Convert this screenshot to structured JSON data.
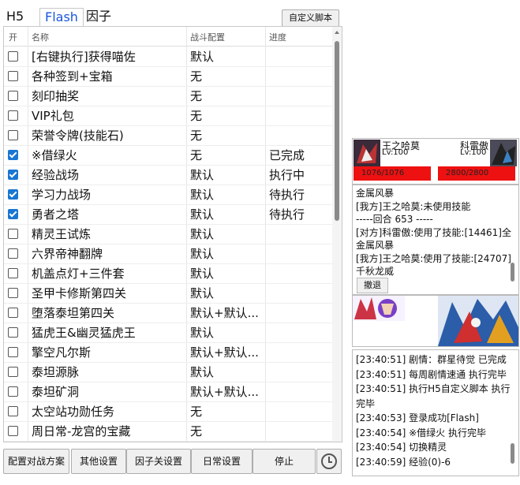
{
  "tabs": [
    {
      "label": "H5"
    },
    {
      "label": "Flash"
    },
    {
      "label": "因子"
    }
  ],
  "custom_script_label": "自定义脚本",
  "table": {
    "headers": {
      "enable": "开",
      "name": "名称",
      "config": "战斗配置",
      "progress": "进度"
    },
    "rows": [
      {
        "checked": false,
        "name": "[右键执行]获得喵佐",
        "config": "默认",
        "progress": ""
      },
      {
        "checked": false,
        "name": "各种签到+宝箱",
        "config": "无",
        "progress": ""
      },
      {
        "checked": false,
        "name": "刻印抽奖",
        "config": "无",
        "progress": ""
      },
      {
        "checked": false,
        "name": "VIP礼包",
        "config": "无",
        "progress": ""
      },
      {
        "checked": false,
        "name": "荣誉令牌(技能石)",
        "config": "无",
        "progress": ""
      },
      {
        "checked": true,
        "name": "※借绿火",
        "config": "无",
        "progress": "已完成"
      },
      {
        "checked": true,
        "name": "经验战场",
        "config": "默认",
        "progress": "执行中"
      },
      {
        "checked": true,
        "name": "学习力战场",
        "config": "默认",
        "progress": "待执行"
      },
      {
        "checked": true,
        "name": "勇者之塔",
        "config": "默认",
        "progress": "待执行"
      },
      {
        "checked": false,
        "name": "精灵王试炼",
        "config": "默认",
        "progress": ""
      },
      {
        "checked": false,
        "name": "六界帝神翻牌",
        "config": "默认",
        "progress": ""
      },
      {
        "checked": false,
        "name": "机盖点灯+三件套",
        "config": "默认",
        "progress": ""
      },
      {
        "checked": false,
        "name": "圣甲卡修斯第四关",
        "config": "默认",
        "progress": ""
      },
      {
        "checked": false,
        "name": "堕落泰坦第四关",
        "config": "默认+默认...",
        "progress": ""
      },
      {
        "checked": false,
        "name": "猛虎王&幽灵猛虎王",
        "config": "默认",
        "progress": ""
      },
      {
        "checked": false,
        "name": "擎空凡尔斯",
        "config": "默认+默认...",
        "progress": ""
      },
      {
        "checked": false,
        "name": "泰坦源脉",
        "config": "默认",
        "progress": ""
      },
      {
        "checked": false,
        "name": "泰坦矿洞",
        "config": "默认+默认...",
        "progress": ""
      },
      {
        "checked": false,
        "name": "太空站功勋任务",
        "config": "无",
        "progress": ""
      },
      {
        "checked": false,
        "name": "周日常-龙宫的宝藏",
        "config": "无",
        "progress": ""
      }
    ]
  },
  "bottom_buttons": [
    "配置对战方案",
    "其他设置",
    "因子关设置",
    "日常设置",
    "停止"
  ],
  "battle": {
    "left": {
      "name": "王之哈莫",
      "level": "Lv:100",
      "hp": "1076/1076",
      "hp_fraction": 1.0
    },
    "right": {
      "name": "科雷傲",
      "level": "Lv:100",
      "hp": "2800/2800",
      "hp_fraction": 1.0
    },
    "hp_color": "#ee1111"
  },
  "battle_log": [
    "金属风暴",
    "[我方]王之哈莫:未使用技能",
    "-----回合 653 -----",
    "[对方]科雷傲:使用了技能:[14461]全",
    "金属风暴",
    "[我方]王之哈莫:使用了技能:[24707]",
    "千秋龙威"
  ],
  "undo_label": "撤退",
  "run_log": [
    "[23:40:51] 剧情：群星待觉 已完成",
    "[23:40:51] 每周剧情速通 执行完毕",
    "[23:40:51] 执行H5自定义脚本 执行",
    "完毕",
    "[23:40:53] 登录成功[Flash]",
    "[23:40:54] ※借绿火 执行完毕",
    "[23:40:54] 切换精灵",
    "[23:40:59] 经验(0)-6"
  ]
}
